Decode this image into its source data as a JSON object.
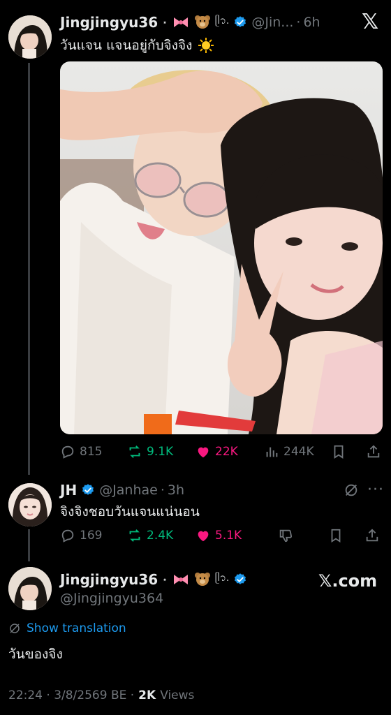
{
  "tweet1": {
    "display_name": "Jingjingyu36",
    "handle": "@Jin...",
    "time": "6h",
    "text": "วันแจน แจนอยู่กับจิงจิง",
    "stats": {
      "replies": "815",
      "reposts": "9.1K",
      "likes": "22K",
      "views": "244K"
    }
  },
  "reply": {
    "display_name": "JH",
    "handle": "@Janhae",
    "time": "3h",
    "text": "จิงจิงชอบวันแจนแน่นอน",
    "stats": {
      "replies": "169",
      "reposts": "2.4K",
      "likes": "5.1K"
    }
  },
  "quote": {
    "display_name": "Jingjingyu36",
    "handle": "@Jingjingyu364",
    "show_translation": "Show translation",
    "text": "วันของจิง",
    "timestamp": "22:24 · 3/8/2569 BE ·",
    "views_count": "2K",
    "views_label": "Views"
  },
  "branding": {
    "x_logo": "𝕏",
    "x_com": "𝕏.com"
  },
  "colors": {
    "verified": "#1d9bf0",
    "like": "#f91880",
    "repost": "#00ba7c",
    "link": "#1d9bf0"
  }
}
